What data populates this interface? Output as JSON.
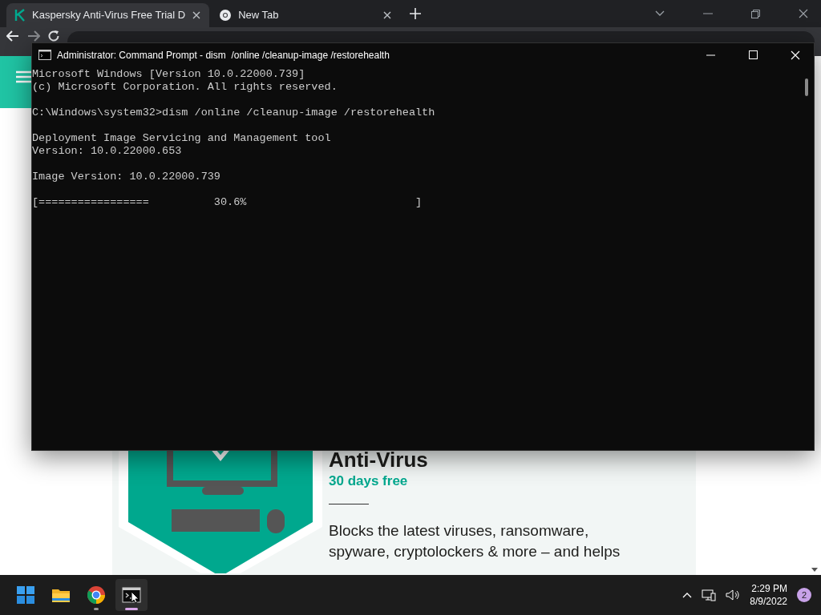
{
  "browser": {
    "tabs": [
      {
        "title": "Kaspersky Anti-Virus Free Trial D",
        "selected": true
      },
      {
        "title": "New Tab",
        "selected": false
      }
    ]
  },
  "page": {
    "product": {
      "title": "Anti-Virus",
      "subtitle": "30 days free",
      "description": "Blocks the latest viruses, ransomware, spyware, cryptolockers & more – and helps"
    }
  },
  "console": {
    "title": "Administrator: Command Prompt - dism  /online /cleanup-image /restorehealth",
    "blocks": [
      [
        "Microsoft Windows [Version 10.0.22000.739]",
        "(c) Microsoft Corporation. All rights reserved."
      ],
      [
        "C:\\Windows\\system32>dism /online /cleanup-image /restorehealth"
      ],
      [
        "Deployment Image Servicing and Management tool",
        "Version: 10.0.22000.653"
      ],
      [
        "Image Version: 10.0.22000.739"
      ],
      [
        "[=================          30.6%                          ]"
      ]
    ]
  },
  "taskbar": {
    "apps": [
      {
        "kind": "start",
        "active": false
      },
      {
        "kind": "explorer",
        "active": false
      },
      {
        "kind": "chrome",
        "active": false,
        "running": true
      },
      {
        "kind": "terminal",
        "active": true,
        "running": true
      }
    ],
    "time": "2:29 PM",
    "date": "8/9/2022",
    "notifications": "2"
  }
}
